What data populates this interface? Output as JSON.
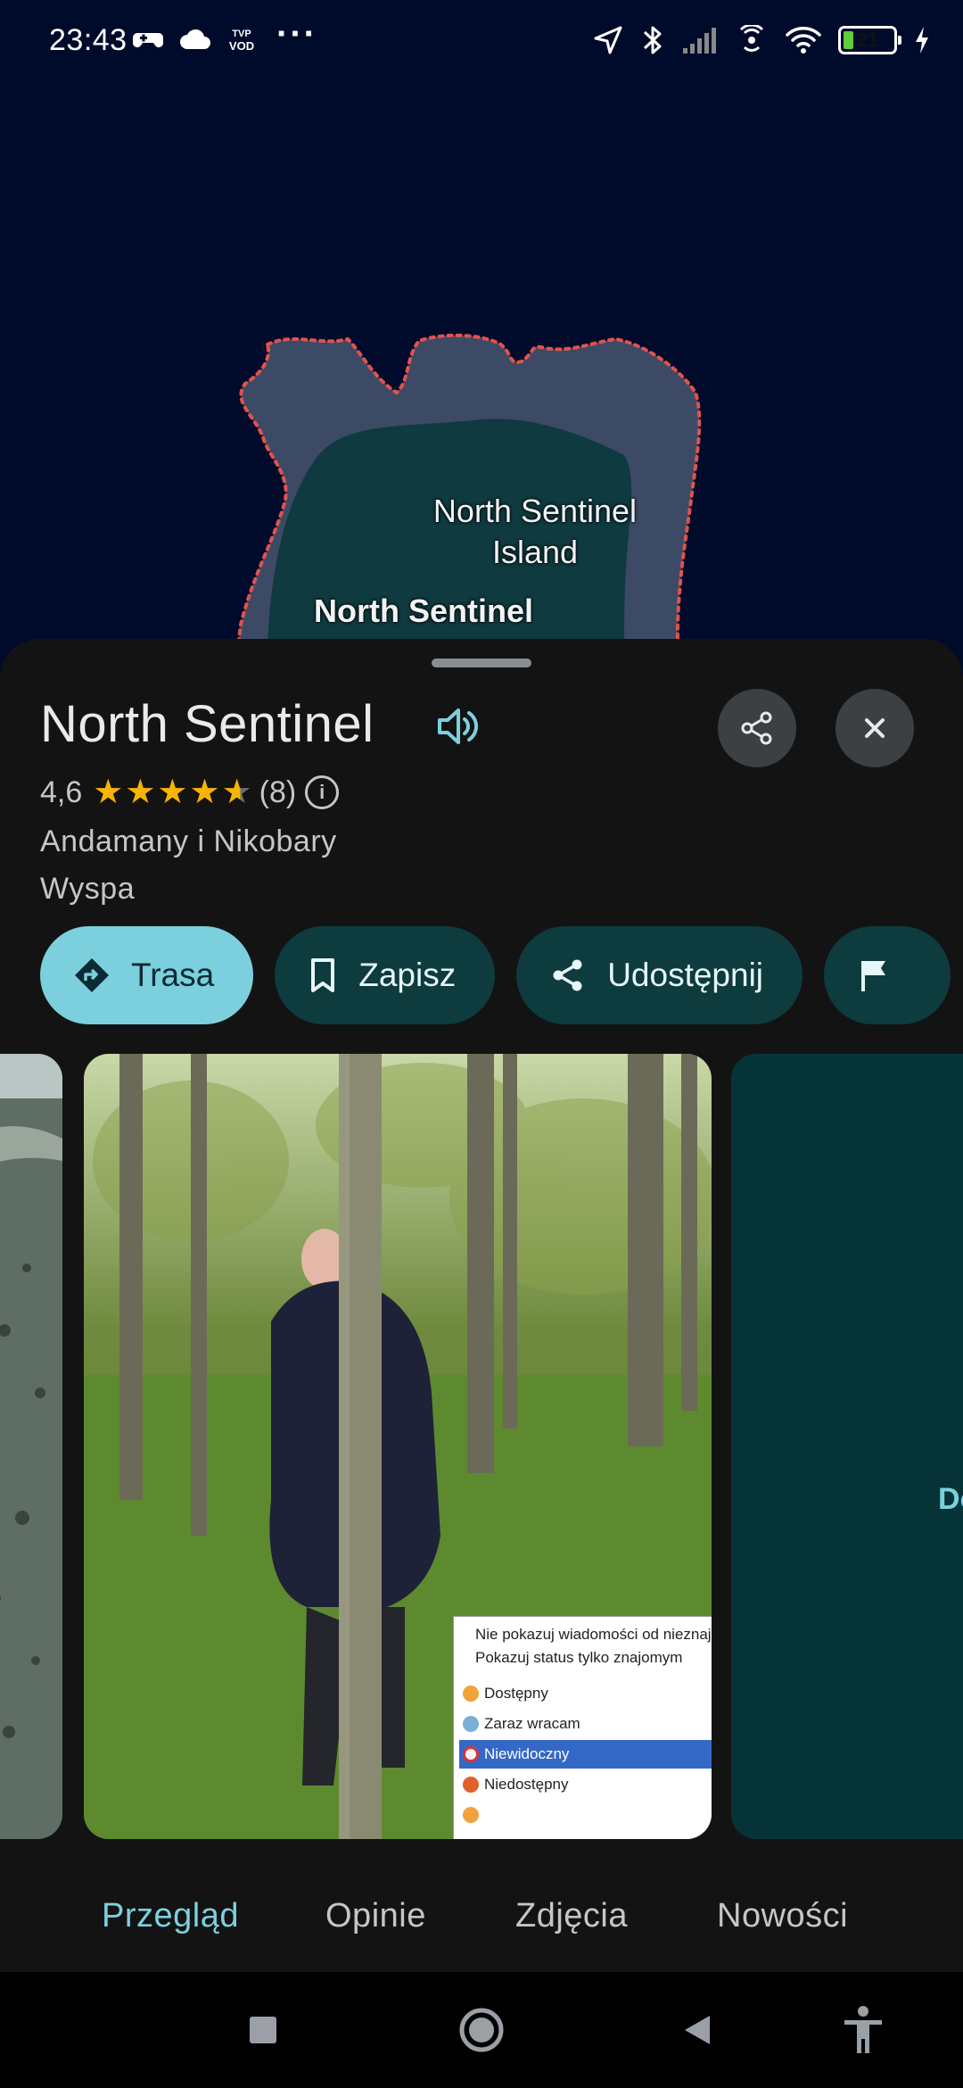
{
  "status_bar": {
    "time": "23:43",
    "left_icons": [
      "game-controller-icon",
      "cloud-icon",
      "tvp-vod-icon"
    ],
    "more": "···",
    "right_icons": [
      "location-icon",
      "bluetooth-icon",
      "signal-icon",
      "hotspot-icon",
      "wifi-icon",
      "battery-icon",
      "charging-icon"
    ],
    "battery_percent": "21",
    "battery_level": 0.21
  },
  "map": {
    "island_label": "North Sentinel Island",
    "island_label_line1": "North Sentinel",
    "island_label_line2": "Island",
    "place_label": "North Sentinel",
    "colors": {
      "sea": "#000a2a",
      "reef": "#3c4a66",
      "land": "#0f3a40",
      "boundary": "#e2524b"
    }
  },
  "place": {
    "title": "North Sentinel",
    "rating": "4,6",
    "rating_value": 4.6,
    "reviews_count": "(8)",
    "region": "Andamany i Nikobary",
    "category": "Wyspa"
  },
  "actions": [
    {
      "label": "Trasa",
      "icon": "directions-icon"
    },
    {
      "label": "Zapisz",
      "icon": "bookmark-icon"
    },
    {
      "label": "Udostępnij",
      "icon": "share-icon"
    },
    {
      "label": "",
      "icon": "flag-icon"
    }
  ],
  "photos": {
    "right_label": "Do",
    "status_menu": {
      "line1": "Nie pokazuj wiadomości od nieznajomych",
      "line2": "Pokazuj status tylko znajomym",
      "statuses": [
        "Dostępny",
        "Zaraz wracam",
        "Niewidoczny",
        "Niedostępny"
      ],
      "selected": "Niewidoczny"
    }
  },
  "tabs": [
    {
      "label": "Przegląd",
      "active": true
    },
    {
      "label": "Opinie",
      "active": false
    },
    {
      "label": "Zdjęcia",
      "active": false
    },
    {
      "label": "Nowości",
      "active": false
    }
  ],
  "nav_bar": [
    "recents-icon",
    "home-icon",
    "back-icon",
    "accessibility-icon"
  ],
  "colors": {
    "accent": "#7cd0de",
    "chip_bg": "#0d3b3e",
    "sheet_bg": "#131314",
    "star": "#f4b400"
  }
}
